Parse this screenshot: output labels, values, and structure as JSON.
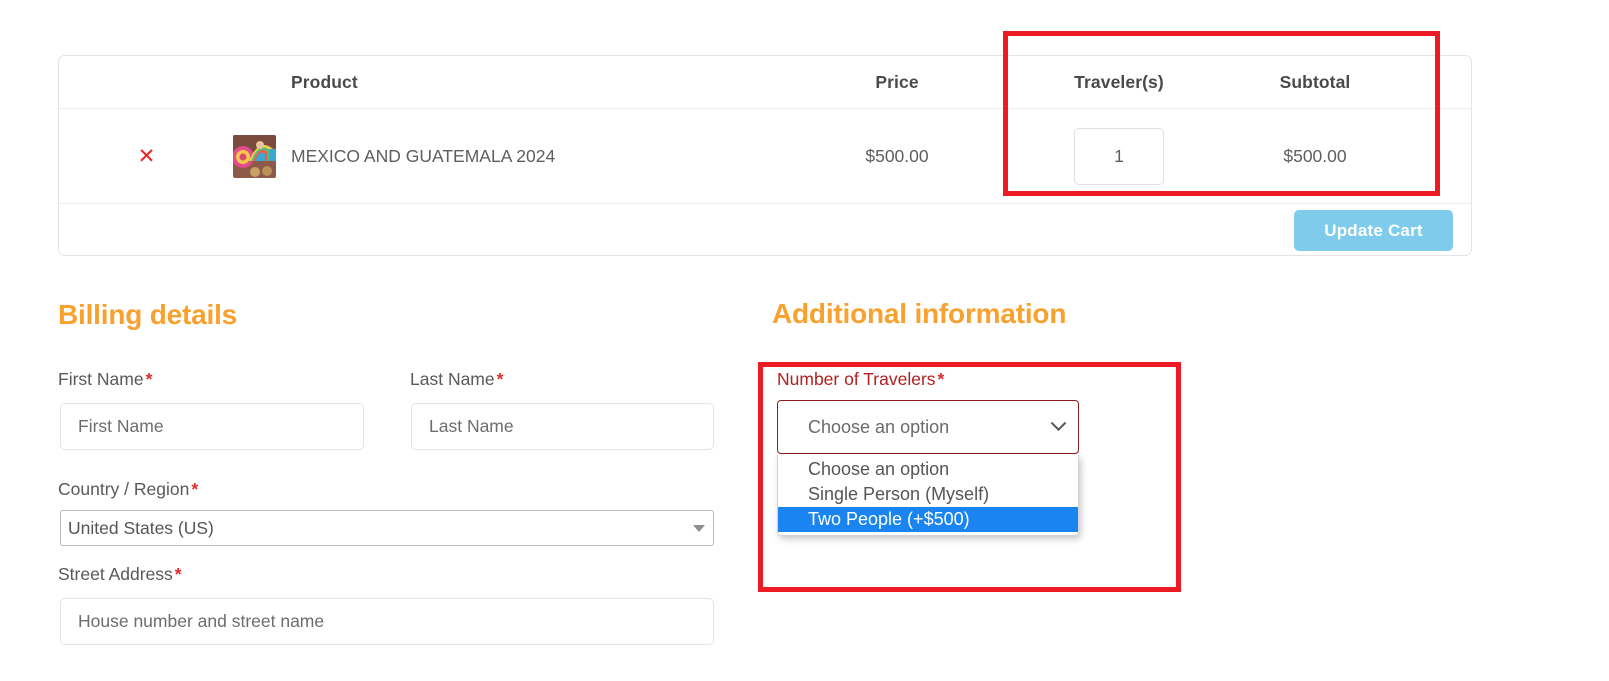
{
  "cart": {
    "columns": {
      "product": "Product",
      "price": "Price",
      "travelers": "Traveler(s)",
      "subtotal": "Subtotal"
    },
    "remove_icon": "remove-x-icon",
    "item": {
      "thumbnail_icon": "product-thumbnail",
      "name": "MEXICO AND GUATEMALA 2024",
      "price": "$500.00",
      "quantity": "1",
      "subtotal": "$500.00"
    },
    "update_cart_label": "Update Cart"
  },
  "billing": {
    "title": "Billing details",
    "required_marker": "*",
    "fields": [
      {
        "label": "First Name",
        "placeholder": "First Name",
        "value": ""
      },
      {
        "label": "Last Name",
        "placeholder": "Last Name",
        "value": ""
      },
      {
        "label": "Country / Region",
        "value": "United States (US)"
      },
      {
        "label": "Street Address",
        "placeholder": "House number and street name",
        "value": ""
      }
    ]
  },
  "additional": {
    "title": "Additional information",
    "travelers_label": "Number of Travelers",
    "required_marker": "*",
    "selected_value": "Choose an option",
    "options": [
      "Choose an option",
      "Single Person (Myself)",
      "Two People (+$500)"
    ],
    "highlighted_option": "Two People (+$500)"
  },
  "colors": {
    "heading_orange": "#F9A12F",
    "button_blue": "#7ecbec",
    "annotation_red": "#ED1C24",
    "required_red": "#e02b2b",
    "dropdown_highlight_blue": "#1A84F0",
    "travelers_label_maroon": "#b02020"
  }
}
